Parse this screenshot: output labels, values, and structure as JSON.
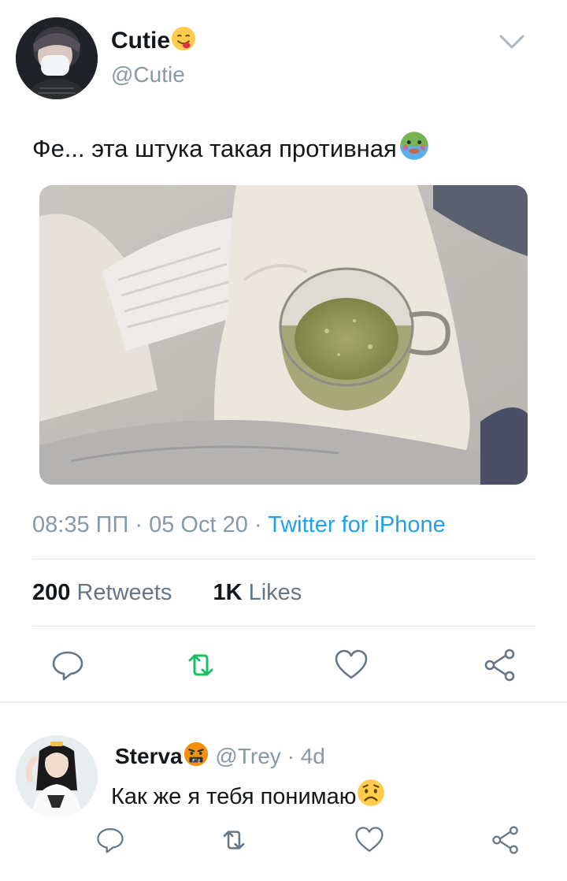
{
  "tweet": {
    "author_name": "Cutie",
    "author_handle": "@Cutie",
    "text": "Фе... эта штука такая противная",
    "time": "08:35 ПП",
    "date": "05 Oct 20",
    "source": "Twitter for iPhone",
    "retweets_count": "200",
    "retweets_label": "Retweets",
    "likes_count": "1K",
    "likes_label": "Likes"
  },
  "icons": {
    "name_emoji": "face-savoring-food-emoji",
    "text_emoji": "nauseated-face-emoji",
    "more": "chevron-down-icon",
    "reply": "reply-icon",
    "retweet": "retweet-icon",
    "like": "heart-icon",
    "share": "share-icon"
  },
  "colors": {
    "accent": "#1da1f2",
    "retweet_active": "#17bf63",
    "secondary_text": "#8899a6"
  },
  "reply": {
    "author_name": "Sterva",
    "author_handle": "@Trey",
    "separator": "·",
    "age": "4d",
    "text": "Как же я тебя понимаю",
    "name_emoji": "face-with-symbols-emoji",
    "text_emoji": "worried-face-emoji"
  }
}
